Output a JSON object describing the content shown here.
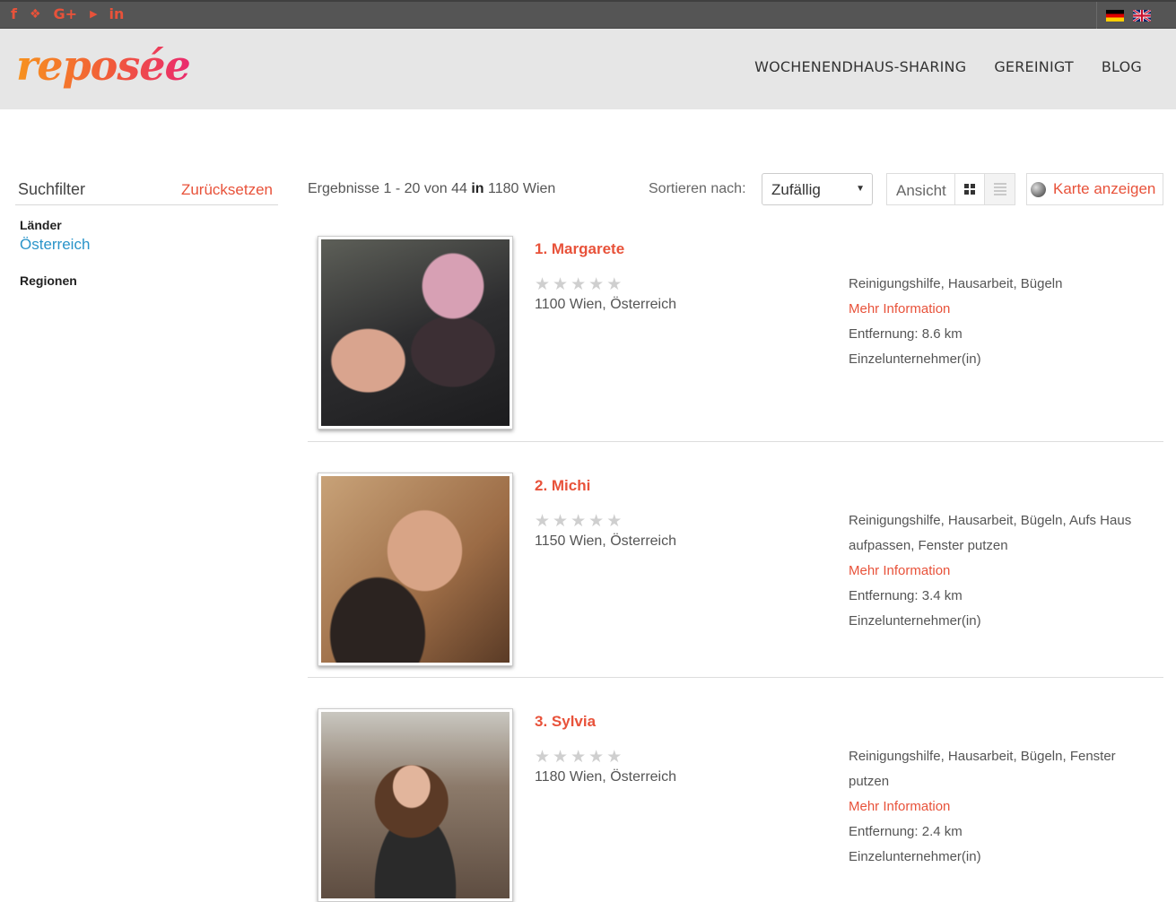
{
  "social": [
    {
      "icon": "facebook-icon",
      "glyph": "f"
    },
    {
      "icon": "twitter-icon",
      "glyph": "🐦"
    },
    {
      "icon": "google-plus-icon",
      "glyph": "G+"
    },
    {
      "icon": "youtube-icon",
      "glyph": "You Tube"
    },
    {
      "icon": "linkedin-icon",
      "glyph": "in"
    }
  ],
  "header": {
    "logo": "reposée",
    "nav": [
      "WOCHENENDHAUS-SHARING",
      "GEREINIGT",
      "BLOG"
    ]
  },
  "sidebar": {
    "title": "Suchfilter",
    "reset": "Zurücksetzen",
    "countries_label": "Länder",
    "country": "Österreich",
    "regions_label": "Regionen"
  },
  "results": {
    "range": "Ergebnisse 1 - 20 von 44",
    "in_word": "in",
    "location": "1180 Wien",
    "sort_label": "Sortieren nach:",
    "sort_value": "Zufällig",
    "view_label": "Ansicht",
    "map_label": "Karte anzeigen"
  },
  "items": [
    {
      "name": "1. Margarete",
      "rating": 0,
      "location": "1100 Wien, Österreich",
      "services": "Reinigungshilfe,  Hausarbeit,  Bügeln",
      "more": "Mehr Information",
      "distance": "Entfernung: 8.6 km",
      "type": "Einzelunternehmer(in)"
    },
    {
      "name": "2. Michi",
      "rating": 0,
      "location": "1150 Wien, Österreich",
      "services": "Reinigungshilfe,  Hausarbeit,  Bügeln,  Aufs Haus aufpassen,  Fenster putzen",
      "more": "Mehr Information",
      "distance": "Entfernung: 3.4 km",
      "type": "Einzelunternehmer(in)"
    },
    {
      "name": "3. Sylvia",
      "rating": 0,
      "location": "1180 Wien, Österreich",
      "services": "Reinigungshilfe,  Hausarbeit,  Bügeln,  Fenster putzen",
      "more": "Mehr Information",
      "distance": "Entfernung: 2.4 km",
      "type": "Einzelunternehmer(in)"
    }
  ],
  "colors": {
    "accent": "#e8523a",
    "link": "#2a94c9",
    "topbar": "#555555",
    "header": "#e6e6e6"
  }
}
